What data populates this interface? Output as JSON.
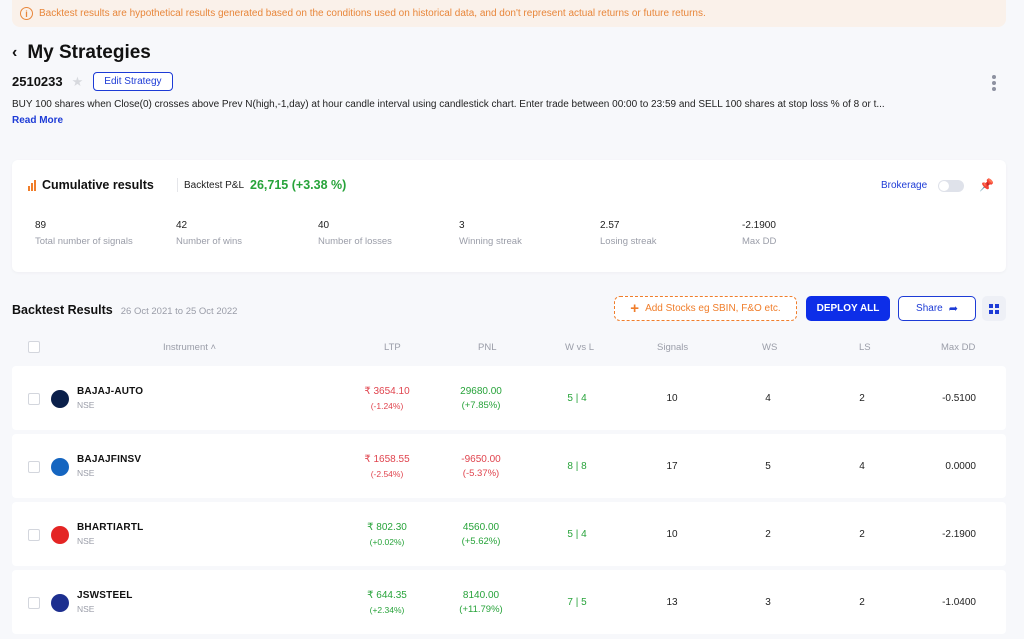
{
  "banner": {
    "text": "Backtest results are hypothetical results generated based on the conditions used on historical data, and don't represent actual returns or future returns."
  },
  "header": {
    "title": "My Strategies"
  },
  "strategy": {
    "id": "2510233",
    "edit_label": "Edit Strategy",
    "description": "BUY 100 shares when Close(0) crosses above Prev N(high,-1,day) at hour candle interval using candlestick chart. Enter trade between 00:00 to 23:59 and SELL 100 shares at stop loss % of 8 or t...",
    "read_more": "Read More"
  },
  "cumulative": {
    "title": "Cumulative results",
    "pnl_label": "Backtest P&L",
    "pnl_value": "26,715 (+3.38 %)",
    "brokerage_label": "Brokerage",
    "stats": [
      {
        "value": "89",
        "label": "Total number of signals"
      },
      {
        "value": "42",
        "label": "Number of wins"
      },
      {
        "value": "40",
        "label": "Number of losses"
      },
      {
        "value": "3",
        "label": "Winning streak"
      },
      {
        "value": "2.57",
        "label": "Losing streak"
      },
      {
        "value": "-2.1900",
        "label": "Max DD"
      }
    ]
  },
  "results": {
    "title": "Backtest Results",
    "range": "26 Oct 2021 to 25 Oct 2022",
    "add_stocks": "Add Stocks eg SBIN, F&O etc.",
    "deploy": "DEPLOY ALL",
    "share": "Share"
  },
  "table": {
    "headers": {
      "instrument": "Instrument",
      "ltp": "LTP",
      "pnl": "PNL",
      "wvl": "W vs L",
      "signals": "Signals",
      "ws": "WS",
      "ls": "LS",
      "maxdd": "Max DD"
    },
    "rows": [
      {
        "symbol": "BAJAJ-AUTO",
        "exchange": "NSE",
        "ltp": "₹ 3654.10",
        "ltp_change": "(-1.24%)",
        "pnl": "29680.00",
        "pnl_pct": "(+7.85%)",
        "wvl": "5 | 4",
        "signals": "10",
        "ws": "4",
        "ls": "2",
        "maxdd": "-0.5100",
        "logo_color": "#0a1f4a",
        "ltp_dir": "down"
      },
      {
        "symbol": "BAJAJFINSV",
        "exchange": "NSE",
        "ltp": "₹ 1658.55",
        "ltp_change": "(-2.54%)",
        "pnl": "-9650.00",
        "pnl_pct": "(-5.37%)",
        "wvl": "8 | 8",
        "signals": "17",
        "ws": "5",
        "ls": "4",
        "maxdd": "0.0000",
        "logo_color": "#1565c0",
        "ltp_dir": "down"
      },
      {
        "symbol": "BHARTIARTL",
        "exchange": "NSE",
        "ltp": "₹ 802.30",
        "ltp_change": "(+0.02%)",
        "pnl": "4560.00",
        "pnl_pct": "(+5.62%)",
        "wvl": "5 | 4",
        "signals": "10",
        "ws": "2",
        "ls": "2",
        "maxdd": "-2.1900",
        "logo_color": "#e42524",
        "ltp_dir": "up"
      },
      {
        "symbol": "JSWSTEEL",
        "exchange": "NSE",
        "ltp": "₹ 644.35",
        "ltp_change": "(+2.34%)",
        "pnl": "8140.00",
        "pnl_pct": "(+11.79%)",
        "wvl": "7 | 5",
        "signals": "13",
        "ws": "3",
        "ls": "2",
        "maxdd": "-1.0400",
        "logo_color": "#1d2f8f",
        "ltp_dir": "up"
      }
    ]
  },
  "colors": {
    "accent": "#0d2ee8",
    "positive": "#27a33a",
    "negative": "#e0444e",
    "warning": "#f07d2a"
  }
}
